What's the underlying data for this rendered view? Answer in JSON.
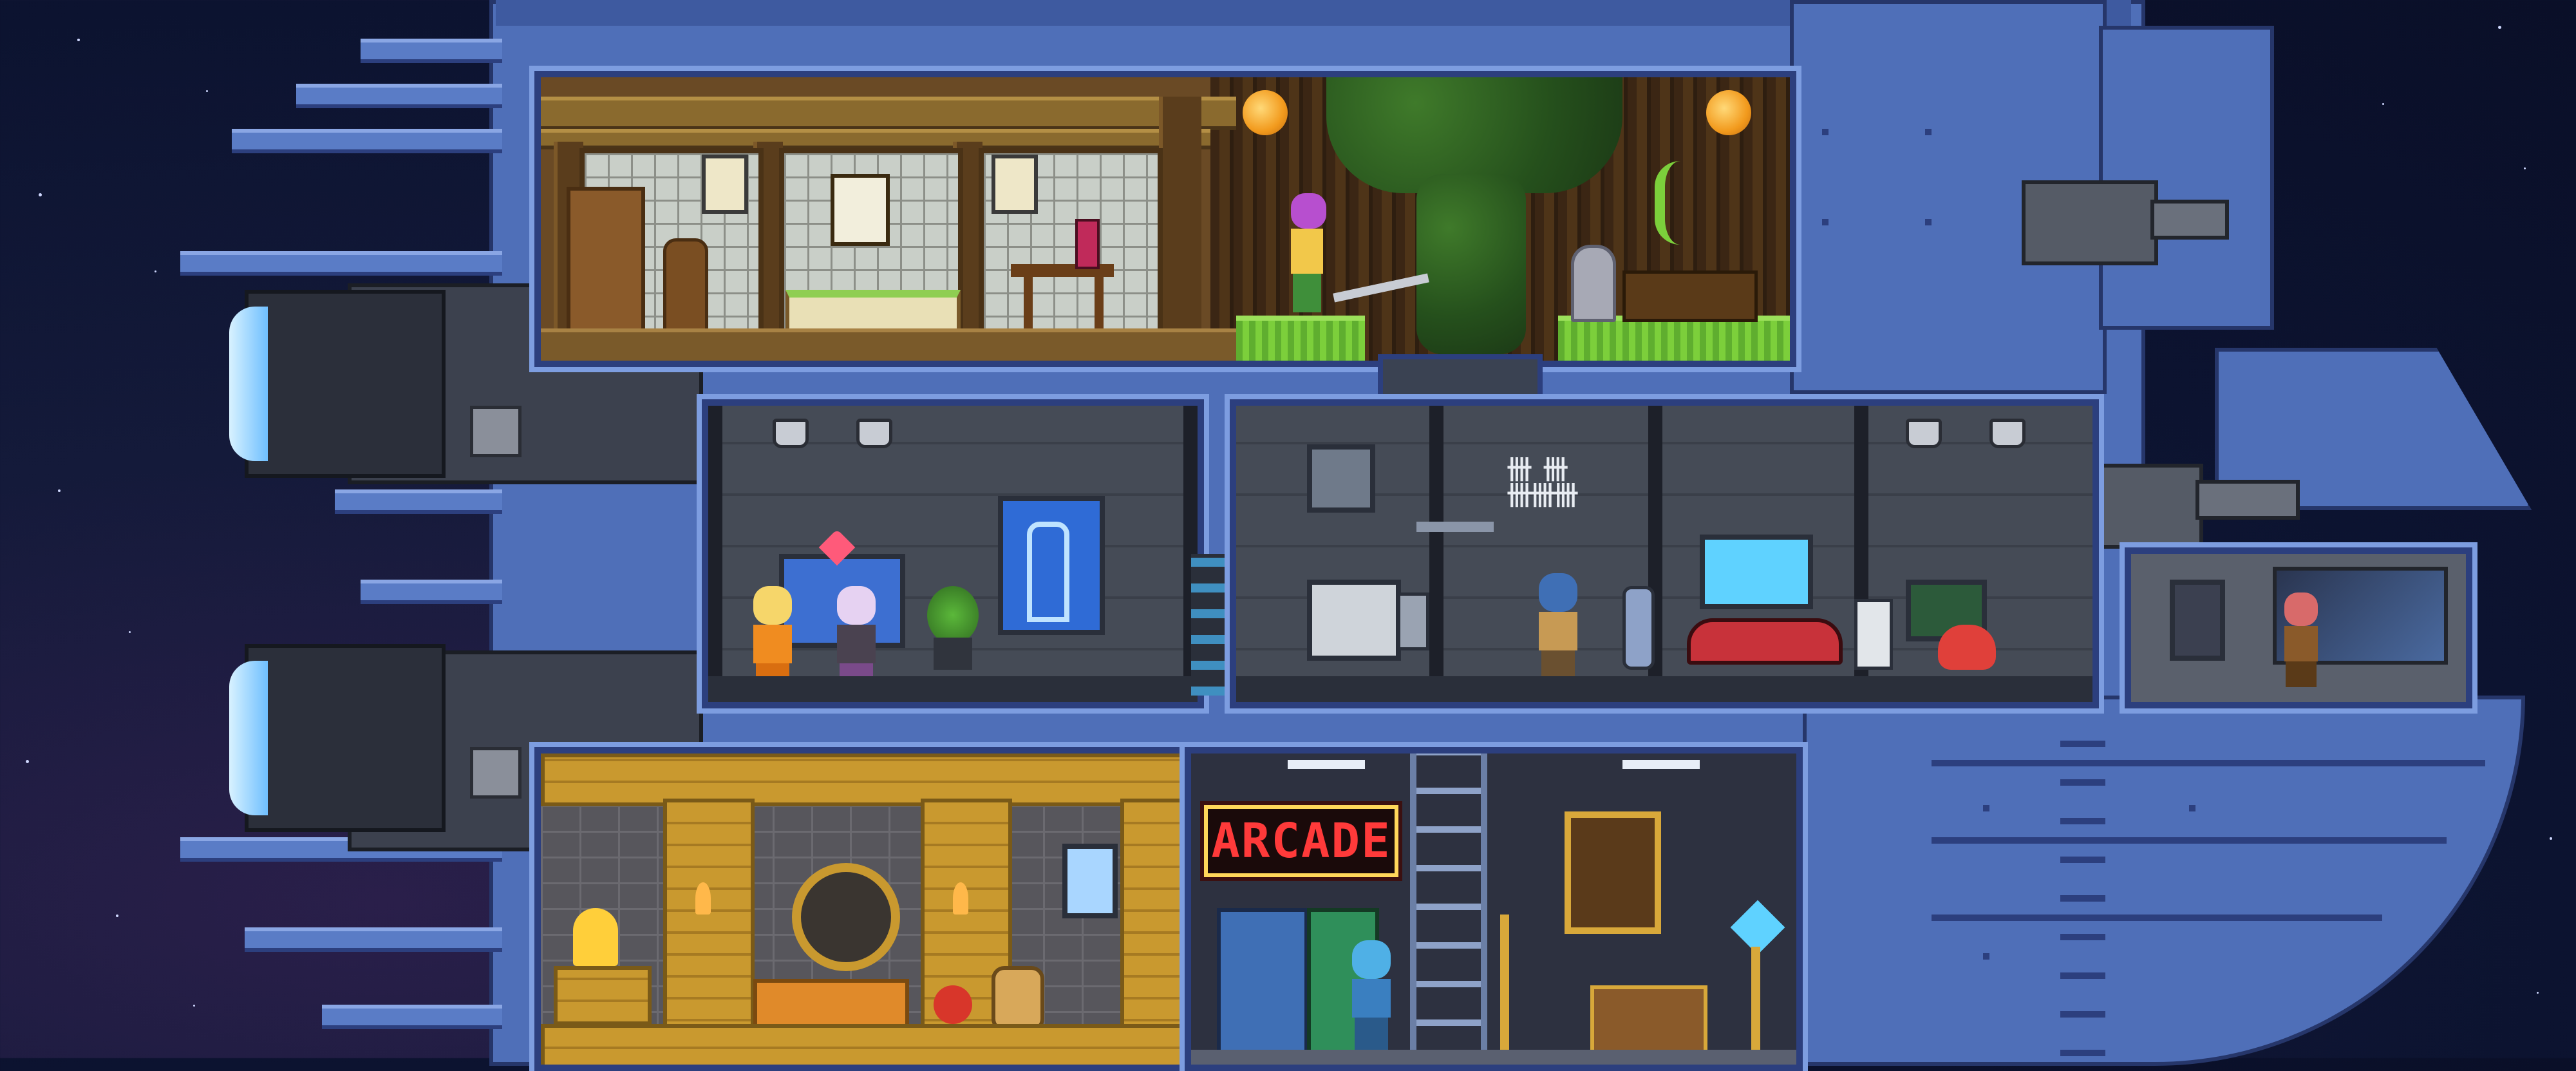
{
  "scene": {
    "type": "spaceship-interior-cutaway",
    "colors": {
      "space": "#0c1330",
      "hull": "#4f6fb8",
      "hull_trim": "#2c3f7e",
      "wood": "#6a4a25",
      "metal": "#454b56",
      "sandstone": "#c9992f",
      "arcade_neon": "#ff3a3a"
    }
  },
  "rooms": {
    "top": {
      "theme": "wooden-dojo-garden"
    },
    "middle_left": {
      "theme": "medical-bay"
    },
    "middle_right": {
      "theme": "crew-quarters"
    },
    "cockpit": {
      "theme": "bridge"
    },
    "bottom_left": {
      "theme": "desert-temple"
    },
    "bottom_right": {
      "theme": "arcade-lounge"
    }
  },
  "signs": {
    "arcade": "ARCADE",
    "tally": "卌 卌\n卌卌卌"
  },
  "icons": {
    "heart": "heart-icon",
    "xray": "skeleton-xray-icon",
    "diamond": "diamond-icon",
    "teleporter": "teleporter-icon"
  }
}
